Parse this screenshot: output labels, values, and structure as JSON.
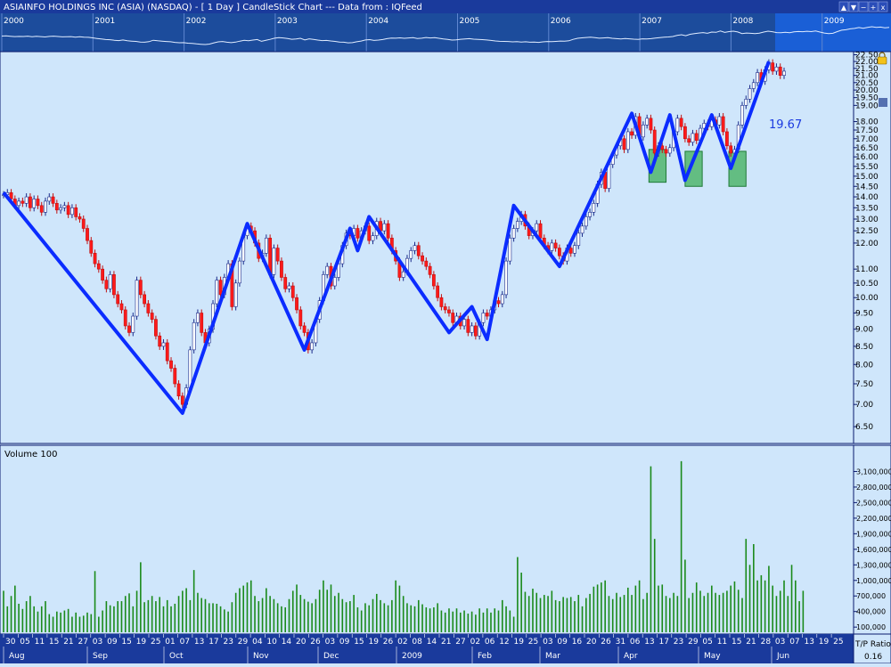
{
  "window": {
    "title": "ASIAINFO HOLDINGS INC (ASIA) (NASDAQ) -  [ 1 Day ] CandleStick Chart --- Data from : IQFeed",
    "buttons": [
      "▲",
      "▼",
      "−",
      "+",
      "x"
    ]
  },
  "overview": {
    "years": [
      "2000",
      "2001",
      "2002",
      "2003",
      "2004",
      "2005",
      "2006",
      "2007",
      "2008",
      "2009"
    ]
  },
  "price_panel": {
    "last_price_label": "19.67",
    "marker_price": "20.50"
  },
  "volume_panel": {
    "label": "Volume 100"
  },
  "date_axis": {
    "days": [
      "30",
      "05",
      "11",
      "15",
      "21",
      "27",
      "03",
      "09",
      "15",
      "19",
      "25",
      "01",
      "07",
      "13",
      "17",
      "23",
      "29",
      "04",
      "10",
      "14",
      "20",
      "26",
      "03",
      "09",
      "15",
      "19",
      "26",
      "02",
      "08",
      "14",
      "21",
      "27",
      "02",
      "06",
      "12",
      "19",
      "25",
      "03",
      "09",
      "16",
      "20",
      "26",
      "31",
      "06",
      "13",
      "17",
      "23",
      "29",
      "05",
      "11",
      "15",
      "21",
      "28",
      "03",
      "07",
      "13",
      "19",
      "25"
    ],
    "months": [
      "Aug",
      "Sep",
      "Oct",
      "Nov",
      "Dec",
      "2009",
      "Feb",
      "Mar",
      "Apr",
      "May",
      "Jun"
    ],
    "corner_label": "T/P Ratio",
    "corner_value": "0.16"
  },
  "chart_data": [
    {
      "type": "candlestick",
      "title": "ASIAINFO HOLDINGS INC (ASIA) (NASDAQ) - [ 1 Day ] CandleStick Chart",
      "x_start": "2008-07-30",
      "x_end": "2009-06-25",
      "y_scale": "log",
      "ylim": [
        6.2,
        22.6
      ],
      "yticks": [
        6.5,
        7.0,
        7.5,
        8.0,
        8.5,
        9.0,
        9.5,
        10.0,
        10.5,
        11.0,
        12.0,
        12.5,
        13.0,
        13.5,
        14.0,
        14.5,
        15.0,
        15.5,
        16.0,
        16.5,
        17.0,
        17.5,
        18.0,
        19.0,
        19.5,
        20.0,
        20.5,
        21.0,
        21.5,
        22.0,
        22.5
      ],
      "close": [
        14.1,
        14.2,
        13.9,
        13.6,
        13.8,
        13.7,
        14.0,
        13.5,
        13.9,
        13.6,
        13.3,
        13.8,
        14.0,
        13.7,
        13.4,
        13.5,
        13.6,
        13.2,
        13.5,
        13.1,
        13.0,
        12.6,
        12.1,
        11.6,
        11.2,
        11.0,
        10.6,
        10.3,
        10.8,
        10.1,
        9.8,
        9.6,
        9.1,
        8.9,
        9.4,
        10.6,
        10.1,
        9.8,
        9.5,
        9.3,
        8.8,
        8.5,
        8.6,
        8.1,
        7.9,
        7.5,
        7.2,
        7.0,
        7.4,
        8.4,
        9.2,
        9.5,
        8.9,
        8.6,
        9.0,
        9.8,
        10.6,
        10.1,
        10.7,
        11.2,
        9.7,
        10.5,
        11.3,
        12.3,
        12.7,
        12.5,
        12.0,
        11.4,
        11.6,
        12.2,
        10.8,
        11.8,
        11.3,
        10.7,
        10.3,
        10.4,
        10.0,
        9.6,
        9.1,
        8.9,
        8.4,
        8.6,
        9.3,
        9.9,
        10.8,
        11.1,
        10.4,
        10.7,
        11.2,
        11.9,
        12.4,
        12.3,
        12.6,
        12.2,
        12.5,
        12.7,
        12.1,
        12.3,
        12.9,
        12.5,
        12.8,
        12.2,
        11.7,
        11.3,
        10.7,
        10.9,
        11.4,
        11.7,
        11.9,
        11.5,
        11.3,
        11.1,
        10.8,
        10.4,
        10.0,
        9.7,
        9.6,
        9.5,
        9.2,
        9.4,
        9.1,
        9.3,
        8.9,
        9.1,
        8.8,
        9.2,
        9.5,
        9.4,
        9.6,
        9.9,
        9.8,
        10.1,
        11.3,
        12.2,
        12.6,
        12.9,
        13.2,
        12.7,
        12.3,
        12.5,
        12.8,
        12.2,
        11.9,
        11.7,
        12.0,
        11.8,
        11.5,
        11.3,
        11.8,
        11.6,
        11.9,
        12.4,
        12.7,
        13.1,
        13.3,
        13.7,
        14.6,
        15.2,
        14.4,
        15.6,
        16.1,
        16.6,
        17.0,
        16.4,
        17.4,
        17.2,
        18.3,
        17.1,
        17.8,
        18.2,
        17.5,
        16.2,
        16.6,
        16.4,
        16.2,
        16.5,
        17.4,
        18.2,
        17.7,
        17.0,
        16.8,
        17.3,
        16.9,
        17.6,
        17.9,
        17.7,
        18.1,
        17.8,
        18.3,
        17.4,
        16.6,
        16.2,
        16.4,
        17.8,
        19.0,
        19.4,
        20.1,
        20.5,
        21.2,
        20.6,
        21.4,
        21.9,
        21.3,
        21.6,
        21.0,
        21.3
      ],
      "volume": [
        800,
        500,
        700,
        900,
        550,
        450,
        600,
        700,
        500,
        400,
        500,
        600,
        350,
        300,
        400,
        380,
        420,
        450,
        300,
        380,
        300,
        320,
        380,
        350,
        1180,
        300,
        420,
        600,
        520,
        500,
        600,
        600,
        700,
        750,
        500,
        800,
        1350,
        580,
        620,
        700,
        600,
        680,
        500,
        620,
        500,
        550,
        700,
        800,
        850,
        620,
        1200,
        760,
        660,
        640,
        560,
        560,
        550,
        500,
        440,
        400,
        580,
        760,
        850,
        900,
        960,
        1000,
        700,
        600,
        660,
        850,
        700,
        640,
        560,
        500,
        480,
        640,
        800,
        920,
        720,
        640,
        590,
        560,
        640,
        820,
        1000,
        820,
        920,
        700,
        760,
        640,
        580,
        600,
        720,
        480,
        420,
        560,
        520,
        640,
        740,
        620,
        560,
        520,
        620,
        1000,
        900,
        700,
        560,
        520,
        500,
        620,
        540,
        480,
        460,
        480,
        560,
        420,
        380,
        460,
        400,
        460,
        380,
        420,
        360,
        400,
        340,
        460,
        380,
        460,
        380,
        460,
        420,
        620,
        500,
        420,
        300,
        1450,
        1150,
        780,
        700,
        840,
        760,
        660,
        720,
        700,
        800,
        620,
        600,
        680,
        660,
        680,
        600,
        720,
        500,
        660,
        740,
        880,
        920,
        960,
        1000,
        700,
        640,
        760,
        680,
        720,
        860,
        720,
        900,
        1000,
        640,
        760,
        3200,
        1800,
        900,
        920,
        700,
        660,
        760,
        700,
        3300,
        1400,
        660,
        760,
        960,
        800,
        700,
        760,
        900,
        760,
        720,
        760,
        800,
        900,
        980,
        820,
        660,
        1800,
        1300,
        1700,
        1000,
        1100,
        1000,
        1280,
        900,
        700,
        800,
        1000,
        700,
        1300,
        1000,
        600,
        800
      ],
      "volume_ylim": [
        0,
        3400000
      ],
      "volume_yticks": [
        100000,
        400000,
        700000,
        1000000,
        1300000,
        1600000,
        1900000,
        2200000,
        2500000,
        2800000,
        3100000
      ],
      "zigzag": [
        [
          0,
          14.2
        ],
        [
          47,
          6.8
        ],
        [
          64,
          12.8
        ],
        [
          79,
          8.4
        ],
        [
          91,
          12.6
        ],
        [
          93,
          11.7
        ],
        [
          96,
          13.1
        ],
        [
          117,
          8.9
        ],
        [
          123,
          9.7
        ],
        [
          127,
          8.7
        ],
        [
          134,
          13.6
        ],
        [
          146,
          11.1
        ],
        [
          165,
          18.5
        ],
        [
          170,
          15.2
        ],
        [
          175,
          18.4
        ],
        [
          179,
          14.8
        ],
        [
          186,
          18.4
        ],
        [
          191,
          15.4
        ],
        [
          201,
          22.0
        ]
      ],
      "zones": [
        {
          "from": 169.5,
          "to": 174.0,
          "low": 14.7,
          "high": 16.4
        },
        {
          "from": 179.0,
          "to": 183.5,
          "low": 14.5,
          "high": 16.3
        },
        {
          "from": 190.5,
          "to": 195.0,
          "low": 14.5,
          "high": 16.3
        }
      ]
    }
  ],
  "colors": {
    "frame": "#0a1a6e",
    "titlebar": "#1a3a9c",
    "plot_bg": "#cfe6fb",
    "zigzag": "#0b2cff",
    "candle_up": "#ffffff",
    "candle_down": "#ff1a1a",
    "volume_bar": "#1a8a1a",
    "zone_fill": "#3faf5a"
  }
}
